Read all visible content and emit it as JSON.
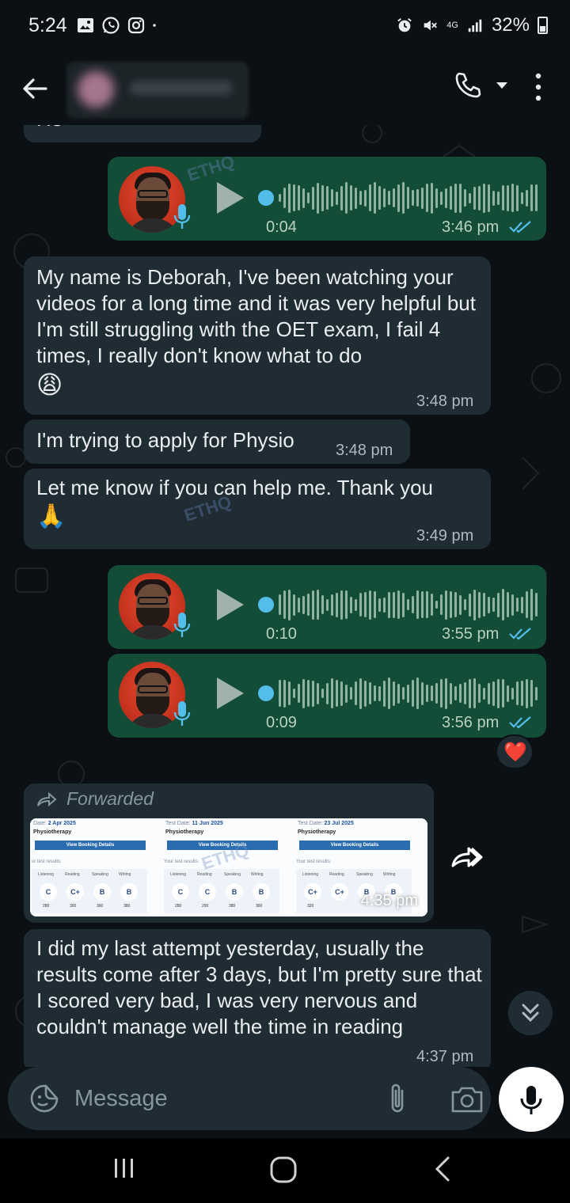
{
  "status_bar": {
    "time": "5:24",
    "network": "4G",
    "battery": "32%"
  },
  "header": {
    "contact_name": ""
  },
  "messages": {
    "partial_top": "He",
    "voice1": {
      "duration": "0:04",
      "time": "3:46 pm"
    },
    "text1": {
      "body": "My name is Deborah, I've been watching your videos for a long time and it was very helpful but I'm still struggling with the OET exam, I fail 4 times, I really don't know what to do",
      "emoji": "😩",
      "time": "3:48 pm"
    },
    "text2": {
      "body": "I'm trying to apply for Physio",
      "time": "3:48 pm"
    },
    "text3": {
      "body": "Let me know if you can help me. Thank you",
      "emoji": "🙏",
      "time": "3:49 pm"
    },
    "voice2": {
      "duration": "0:10",
      "time": "3:55 pm"
    },
    "voice3": {
      "duration": "0:09",
      "time": "3:56 pm",
      "reaction": "❤️"
    },
    "forwarded": {
      "label": "Forwarded",
      "time": "4:35 pm",
      "panels": [
        {
          "test_date_label": "Date:",
          "test_date": "2 Apr 2025",
          "test_name": "Physiotherapy",
          "button": "View Booking Details",
          "results_label": "ur test results:",
          "skills": [
            "Listening",
            "Reading",
            "Speaking",
            "Writing"
          ],
          "grades": [
            "C",
            "C+",
            "B",
            "B"
          ],
          "scores": [
            "280",
            "300",
            "360",
            "380"
          ]
        },
        {
          "test_date_label": "Test Date:",
          "test_date": "11 Jun 2025",
          "test_name": "Physiotherapy",
          "button": "View Booking Details",
          "results_label": "Your test results:",
          "skills": [
            "Listening",
            "Reading",
            "Speaking",
            "Writing"
          ],
          "grades": [
            "C",
            "C",
            "B",
            "B"
          ],
          "scores": [
            "280",
            "290",
            "380",
            "360"
          ]
        },
        {
          "test_date_label": "Test Date:",
          "test_date": "23 Jul 2025",
          "test_name": "Physiotherapy",
          "button": "View Booking Details",
          "results_label": "Your test results:",
          "skills": [
            "Listening",
            "Reading",
            "Speaking",
            "Writing"
          ],
          "grades": [
            "C+",
            "C+",
            "B",
            "B"
          ],
          "scores": [
            "320",
            "",
            "",
            ""
          ]
        }
      ]
    },
    "text4": {
      "body": "I did my last attempt yesterday, usually the results come after 3 days, but I'm pretty sure that I scored very bad, I was very nervous and couldn't manage well the time in reading",
      "time": "4:37 pm"
    }
  },
  "watermark": "ETHQ",
  "composer": {
    "placeholder": "Message"
  },
  "colors": {
    "incoming": "#1f2c33",
    "outgoing": "#144d37",
    "background": "#0b1014",
    "read_ticks": "#53bdeb"
  }
}
